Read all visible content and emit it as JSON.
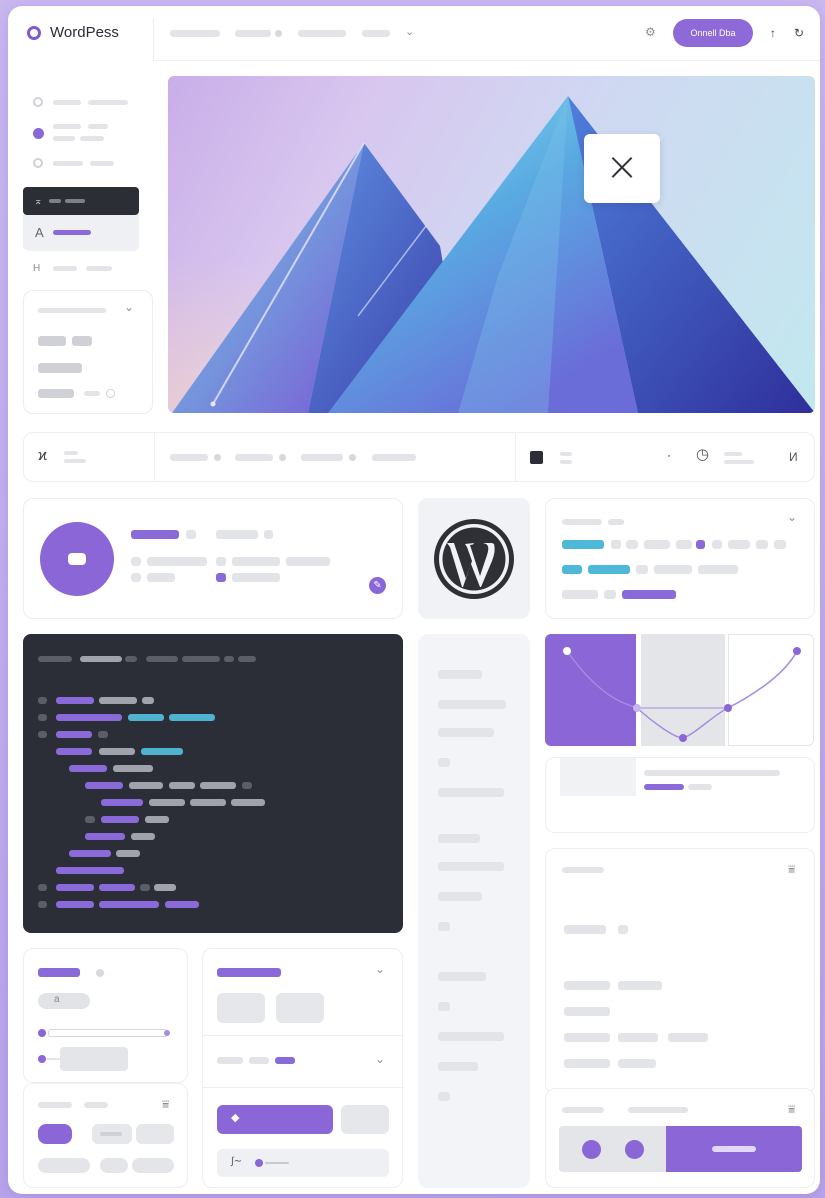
{
  "app": {
    "brand": "WordPess"
  },
  "header": {
    "primary_button_label": "Onnell Dba"
  },
  "colors": {
    "accent": "#8a66d6",
    "cyan": "#4db8d8",
    "dark": "#2b2d37",
    "background": "#c9b8ef"
  },
  "icons": {
    "logo": "logo-ring-icon",
    "close": "close-icon",
    "wordpress": "wordpress-logo-icon",
    "settings": "settings-icon",
    "upload": "upload-icon",
    "filter": "filter-icon",
    "chevron": "chevron-down-icon"
  },
  "glyphs": {
    "close": "×",
    "gear": "⚙",
    "upload": "↑",
    "refresh": "↻",
    "chevron": "⌄",
    "side_a": "A",
    "side_h": "H",
    "side_arrow": "⌅",
    "toolbar_left": "ϰ",
    "toolbar_sym": "ᐧ",
    "toolbar_clock": "◷",
    "toolbar_end": "И",
    "diamond": "◆",
    "filter": "⩸",
    "small_a": "a",
    "scribble": "∫∼",
    "edit": "✎"
  }
}
